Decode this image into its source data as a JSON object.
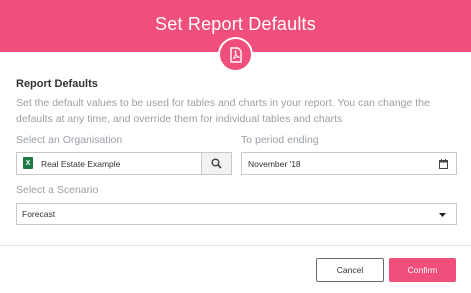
{
  "dialog": {
    "title": "Set Report Defaults",
    "header_icon": "pdf-icon",
    "accent_color": "#f04e7b"
  },
  "section": {
    "title": "Report Defaults",
    "description": "Set the default values to be used for tables and charts in your report. You can change the defaults at any time, and override them for individual tables and charts"
  },
  "organisation": {
    "label": "Select an Organisation",
    "value": "Real Estate Example",
    "icon": "excel-icon",
    "search_icon": "search-icon"
  },
  "period": {
    "label": "To period ending",
    "value": "November '18",
    "icon": "calendar-icon"
  },
  "scenario": {
    "label": "Select a Scenario",
    "value": "Forecast",
    "icon": "caret-down-icon"
  },
  "footer": {
    "cancel_label": "Cancel",
    "confirm_label": "Confirm"
  }
}
